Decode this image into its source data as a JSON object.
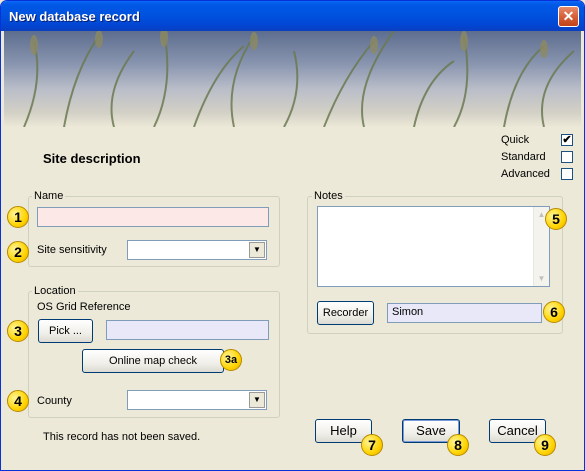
{
  "window": {
    "title": "New database record",
    "close_glyph": "✕"
  },
  "mode": {
    "quick_label": "Quick",
    "quick_checked": "✔",
    "standard_label": "Standard",
    "advanced_label": "Advanced"
  },
  "section_title": "Site description",
  "name_group": {
    "legend": "Name",
    "name_value": "",
    "sensitivity_label": "Site sensitivity",
    "sensitivity_value": ""
  },
  "location_group": {
    "legend": "Location",
    "grid_ref_label": "OS Grid Reference",
    "pick_button": "Pick ...",
    "grid_ref_value": "",
    "map_check_button": "Online map check",
    "county_label": "County",
    "county_value": ""
  },
  "notes_group": {
    "legend": "Notes",
    "notes_value": "",
    "recorder_button": "Recorder",
    "recorder_value": "Simon"
  },
  "status_text": "This record has not been saved.",
  "footer": {
    "help_button": "Help",
    "save_button": "Save",
    "cancel_button": "Cancel"
  },
  "badges": {
    "b1": "1",
    "b2": "2",
    "b3": "3",
    "b3a": "3a",
    "b4": "4",
    "b5": "5",
    "b6": "6",
    "b7": "7",
    "b8": "8",
    "b9": "9"
  },
  "icons": {
    "close": "close-icon",
    "dropdown": "chevron-down-icon",
    "check": "checkmark-icon"
  },
  "colors": {
    "titlebar": "#0053df",
    "window_bg": "#ece9d8",
    "badge": "#ffd400",
    "name_field_bg": "#fde8e8",
    "lavender_field_bg": "#e8e8f8"
  }
}
